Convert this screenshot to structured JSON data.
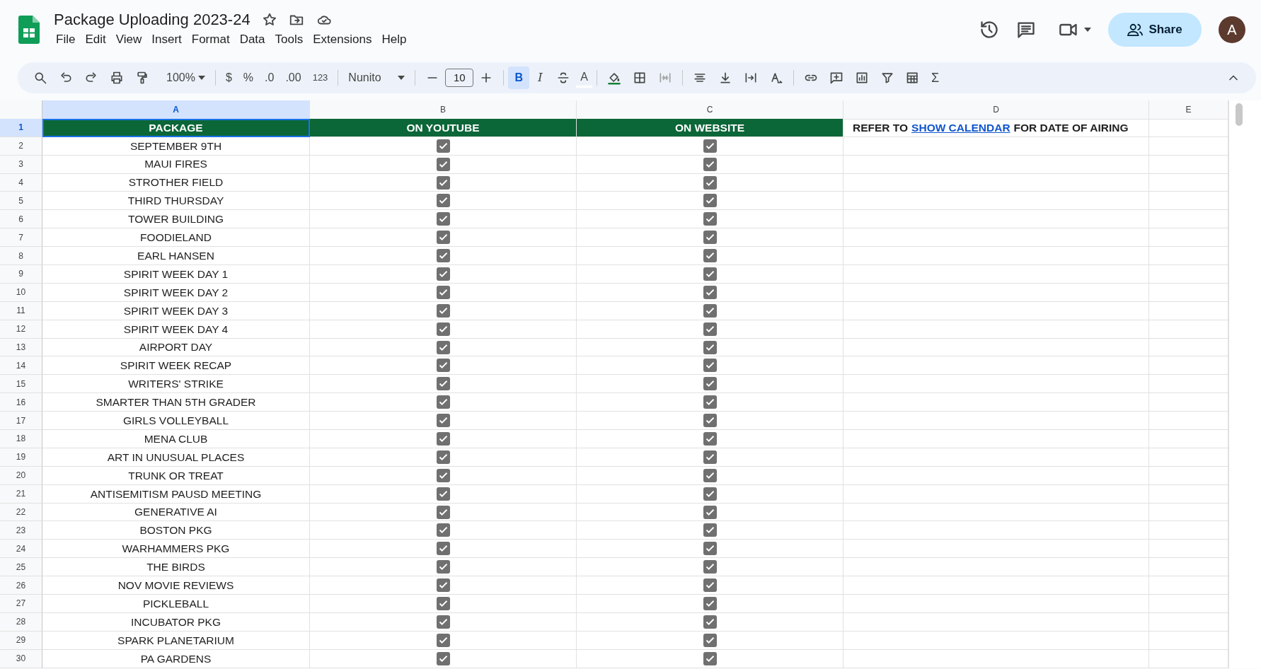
{
  "document": {
    "title": "Package Uploading 2023-24",
    "menu": [
      "File",
      "Edit",
      "View",
      "Insert",
      "Format",
      "Data",
      "Tools",
      "Extensions",
      "Help"
    ]
  },
  "header_actions": {
    "share": "Share",
    "avatar": "A"
  },
  "toolbar": {
    "zoom": "100%",
    "currency": "$",
    "percent": "%",
    "decrease_decimal": ".0",
    "increase_decimal": ".00",
    "number_format": "123",
    "font": "Nunito",
    "font_size": "10",
    "bold": {
      "label": "B",
      "selected": true
    },
    "italic": {
      "label": "I",
      "selected": false
    },
    "text_color": "A",
    "functions": "Σ"
  },
  "columns": [
    {
      "label": "A",
      "selected": true
    },
    {
      "label": "B",
      "selected": false
    },
    {
      "label": "C",
      "selected": false
    },
    {
      "label": "D",
      "selected": false
    },
    {
      "label": "E",
      "selected": false
    }
  ],
  "header_row": {
    "number": "1",
    "selected": true,
    "cells": [
      "PACKAGE",
      "ON YOUTUBE",
      "ON WEBSITE"
    ],
    "note": {
      "before": "REFER TO",
      "link": "SHOW CALENDAR",
      "after": "FOR DATE OF AIRING"
    }
  },
  "rows": [
    {
      "number": "2",
      "package": "SEPTEMBER 9TH",
      "on_youtube": true,
      "on_website": true
    },
    {
      "number": "3",
      "package": "MAUI FIRES",
      "on_youtube": true,
      "on_website": true
    },
    {
      "number": "4",
      "package": "STROTHER FIELD",
      "on_youtube": true,
      "on_website": true
    },
    {
      "number": "5",
      "package": "THIRD THURSDAY",
      "on_youtube": true,
      "on_website": true
    },
    {
      "number": "6",
      "package": "TOWER BUILDING",
      "on_youtube": true,
      "on_website": true
    },
    {
      "number": "7",
      "package": "FOODIELAND",
      "on_youtube": true,
      "on_website": true
    },
    {
      "number": "8",
      "package": "EARL HANSEN",
      "on_youtube": true,
      "on_website": true
    },
    {
      "number": "9",
      "package": "SPIRIT WEEK DAY 1",
      "on_youtube": true,
      "on_website": true
    },
    {
      "number": "10",
      "package": "SPIRIT WEEK DAY 2",
      "on_youtube": true,
      "on_website": true
    },
    {
      "number": "11",
      "package": "SPIRIT WEEK DAY 3",
      "on_youtube": true,
      "on_website": true
    },
    {
      "number": "12",
      "package": "SPIRIT WEEK DAY 4",
      "on_youtube": true,
      "on_website": true
    },
    {
      "number": "13",
      "package": "AIRPORT DAY",
      "on_youtube": true,
      "on_website": true
    },
    {
      "number": "14",
      "package": "SPIRIT WEEK RECAP",
      "on_youtube": true,
      "on_website": true
    },
    {
      "number": "15",
      "package": "WRITERS' STRIKE",
      "on_youtube": true,
      "on_website": true
    },
    {
      "number": "16",
      "package": "SMARTER THAN 5TH GRADER",
      "on_youtube": true,
      "on_website": true
    },
    {
      "number": "17",
      "package": "GIRLS VOLLEYBALL",
      "on_youtube": true,
      "on_website": true
    },
    {
      "number": "18",
      "package": "MENA CLUB",
      "on_youtube": true,
      "on_website": true
    },
    {
      "number": "19",
      "package": "ART IN UNUSUAL PLACES",
      "on_youtube": true,
      "on_website": true
    },
    {
      "number": "20",
      "package": "TRUNK OR TREAT",
      "on_youtube": true,
      "on_website": true
    },
    {
      "number": "21",
      "package": "ANTISEMITISM PAUSD MEETING",
      "on_youtube": true,
      "on_website": true
    },
    {
      "number": "22",
      "package": "GENERATIVE AI",
      "on_youtube": true,
      "on_website": true
    },
    {
      "number": "23",
      "package": "BOSTON PKG",
      "on_youtube": true,
      "on_website": true
    },
    {
      "number": "24",
      "package": "WARHAMMERS PKG",
      "on_youtube": true,
      "on_website": true
    },
    {
      "number": "25",
      "package": "THE BIRDS",
      "on_youtube": true,
      "on_website": true
    },
    {
      "number": "26",
      "package": "NOV MOVIE REVIEWS",
      "on_youtube": true,
      "on_website": true
    },
    {
      "number": "27",
      "package": "PICKLEBALL",
      "on_youtube": true,
      "on_website": true
    },
    {
      "number": "28",
      "package": "INCUBATOR PKG",
      "on_youtube": true,
      "on_website": true
    },
    {
      "number": "29",
      "package": "SPARK PLANETARIUM",
      "on_youtube": true,
      "on_website": true
    },
    {
      "number": "30",
      "package": "PA GARDENS",
      "on_youtube": true,
      "on_website": true
    }
  ]
}
